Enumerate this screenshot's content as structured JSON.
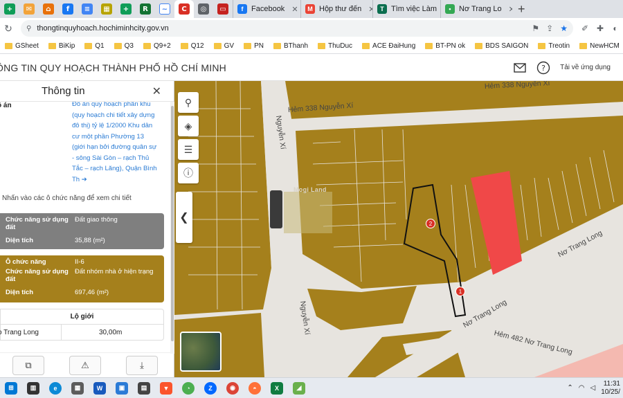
{
  "browser": {
    "tabs": [
      {
        "label": "Facebook",
        "color": "#1877f2",
        "glyph": "f"
      },
      {
        "label": "Hộp thư đến",
        "color": "#ea4335",
        "glyph": "M"
      },
      {
        "label": "Tìm việc Làm",
        "color": "#0b6e4f",
        "glyph": "T"
      },
      {
        "label": "Nơ Trang Lo",
        "color": "#34a853",
        "glyph": "•"
      }
    ],
    "new_tab": "+",
    "url": "thongtinquyhoach.hochiminhcity.gov.vn",
    "bookmarks": [
      "GSheet",
      "BiKip",
      "Q1",
      "Q3",
      "Q9+2",
      "Q12",
      "GV",
      "PN",
      "BThanh",
      "ThuDuc",
      "ACE ĐaiHung",
      "BT-PN ok",
      "BDS SAIGON",
      "Treotin",
      "NewHCM"
    ],
    "bookmarks_more": "»"
  },
  "site": {
    "title": "ÔNG TIN QUY HOẠCH THÀNH PHỐ HỒ CHÍ MINH",
    "download_link": "Tải về ứng dụng"
  },
  "panel": {
    "title": "Thông tin",
    "doan_label": "ồ án",
    "doan_text": "Đồ án quy hoạch phân khu (quy hoạch chi tiết xây dựng đô thị) tỷ lệ 1/2000 Khu dân cư một phần Phường 13 (giới hạn bởi đường quân sự - sông Sài Gòn – rạch Thủ Tắc – rạch Lăng), Quận Bình Th",
    "hint": "Nhấn vào các ô chức năng để xem chi tiết",
    "card_grey": {
      "func_label": "Chức năng sử dụng đất",
      "func_value": "Đất giao thông",
      "area_label": "Diện tích",
      "area_value": "35,88 (m²)"
    },
    "card_brown": {
      "cell_label": "Ô chức năng",
      "cell_value": "II-6",
      "func_label": "Chức năng sử dụng đất",
      "func_value": "Đất nhóm nhà ở hiện trạng",
      "area_label": "Diện tích",
      "area_value": "697,46 (m²)"
    },
    "logioi": {
      "header": "Lộ giới",
      "road": "o Trang Long",
      "width": "30,00m"
    }
  },
  "map": {
    "labels": {
      "hem_top": "Hẻm 338 Nguyễn Xí",
      "hem_mid": "Hẻm 338 Nguyễn Xí",
      "nguyen_xi_top": "Nguyễn Xí",
      "nguyen_xi_bottom": "Nguyễn Xí",
      "no_trang_long_right": "Nơ Trang Long",
      "no_trang_long_mid": "Nơ Trang Long",
      "hem_482": "Hẻm 482 Nơ Trang Long"
    },
    "watermark": "Mogi Land",
    "pin1": "1",
    "pin2": "2",
    "colors": {
      "residential": "#a5801c",
      "road": "#e7e4df",
      "highlight": "#f04848",
      "outline": "#111111"
    }
  },
  "taskbar": {
    "time": "11:31",
    "date": "10/25/"
  }
}
